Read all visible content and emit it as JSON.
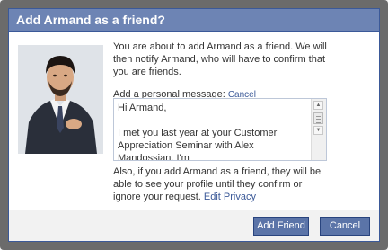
{
  "dialog": {
    "title": "Add Armand as a friend?",
    "intro": "You are about to add Armand as a friend. We will then notify Armand, who will have to confirm that you are friends.",
    "message_label": "Add a personal message:",
    "message_cancel_link": "Cancel",
    "message_lines": {
      "line1": "Hi Armand,",
      "line2": "I met you last year at your Customer Appreciation Seminar with Alex ",
      "misspelled": "Mandossian",
      "line3": ". I'm"
    },
    "privacy_note": "Also, if you add Armand as a friend, they will be able to see your profile until they confirm or ignore your request.",
    "privacy_link": "Edit Privacy",
    "buttons": {
      "add": "Add Friend",
      "cancel": "Cancel"
    }
  },
  "colors": {
    "titlebar": "#6d84b4",
    "border": "#3b5998",
    "button": "#5b74a8",
    "link": "#3b5998"
  }
}
